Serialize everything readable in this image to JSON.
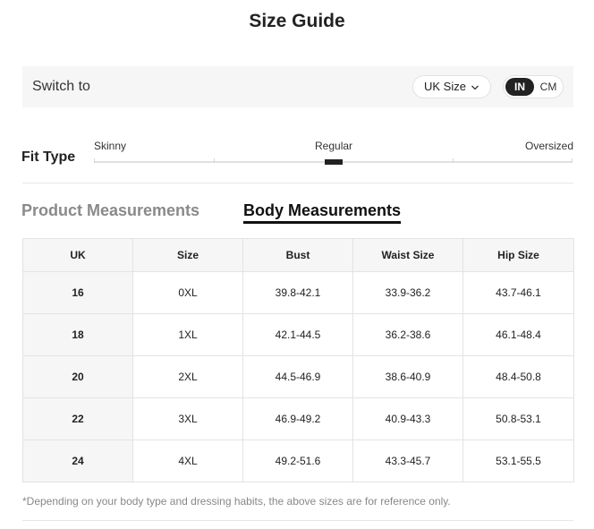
{
  "title": "Size Guide",
  "switch": {
    "label": "Switch to",
    "size_system": "UK Size",
    "units": [
      "IN",
      "CM"
    ],
    "active_unit": "IN"
  },
  "fit_type": {
    "label": "Fit Type",
    "options": [
      "Skinny",
      "Regular",
      "Oversized"
    ],
    "selected": "Regular"
  },
  "tabs": {
    "product": "Product Measurements",
    "body": "Body Measurements",
    "active": "Body Measurements"
  },
  "table": {
    "headers": [
      "UK",
      "Size",
      "Bust",
      "Waist Size",
      "Hip Size"
    ],
    "rows": [
      [
        "16",
        "0XL",
        "39.8-42.1",
        "33.9-36.2",
        "43.7-46.1"
      ],
      [
        "18",
        "1XL",
        "42.1-44.5",
        "36.2-38.6",
        "46.1-48.4"
      ],
      [
        "20",
        "2XL",
        "44.5-46.9",
        "38.6-40.9",
        "48.4-50.8"
      ],
      [
        "22",
        "3XL",
        "46.9-49.2",
        "40.9-43.3",
        "50.8-53.1"
      ],
      [
        "24",
        "4XL",
        "49.2-51.6",
        "43.3-45.7",
        "53.1-55.5"
      ]
    ]
  },
  "note": "*Depending on your body type and dressing habits, the above sizes are for reference only.",
  "colors": {
    "accent": "#222222",
    "panel": "#f6f6f6",
    "muted": "#8a8a8a"
  }
}
